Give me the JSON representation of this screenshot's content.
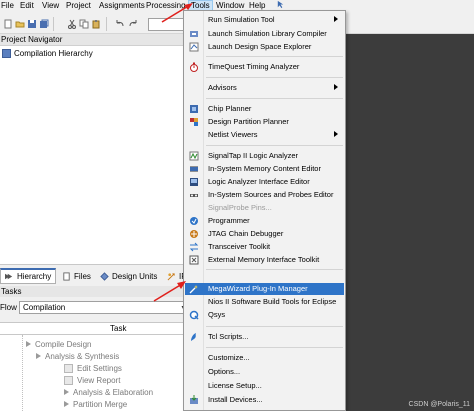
{
  "menubar": {
    "items": [
      "File",
      "Edit",
      "View",
      "Project",
      "Assignments",
      "Processing",
      "Tools",
      "Window",
      "Help"
    ]
  },
  "project_navigator": {
    "title": "Project Navigator",
    "root": "Compilation Hierarchy",
    "tabs": [
      "Hierarchy",
      "Files",
      "Design Units",
      "IP"
    ]
  },
  "tasks": {
    "title": "Tasks",
    "flow_label": "Flow:",
    "flow_value": "Compilation",
    "column_header": "Task",
    "rows": [
      "Compile Design",
      "Analysis & Synthesis",
      "Edit Settings",
      "View Report",
      "Analysis & Elaboration",
      "Partition Merge"
    ]
  },
  "tools_menu": {
    "items": [
      {
        "label": "Run Simulation Tool",
        "submenu": true,
        "icon": "simulation-icon"
      },
      {
        "label": "Launch Simulation Library Compiler",
        "icon": "library-compiler-icon"
      },
      {
        "label": "Launch Design Space Explorer",
        "icon": "design-space-explorer-icon"
      },
      {
        "label": "TimeQuest Timing Analyzer",
        "icon": "stopwatch-icon"
      },
      {
        "label": "Advisors",
        "submenu": true
      },
      {
        "label": "Chip Planner",
        "icon": "chip-planner-icon"
      },
      {
        "label": "Design Partition Planner",
        "icon": "partition-planner-icon"
      },
      {
        "label": "Netlist Viewers",
        "submenu": true
      },
      {
        "label": "SignalTap II Logic Analyzer",
        "icon": "signaltap-icon"
      },
      {
        "label": "In-System Memory Content Editor",
        "icon": "memory-editor-icon"
      },
      {
        "label": "Logic Analyzer Interface Editor",
        "icon": "logic-analyzer-icon"
      },
      {
        "label": "In-System Sources and Probes Editor",
        "icon": "sources-probes-icon"
      },
      {
        "label": "SignalProbe Pins...",
        "disabled": true
      },
      {
        "label": "Programmer",
        "icon": "programmer-icon"
      },
      {
        "label": "JTAG Chain Debugger",
        "icon": "jtag-icon"
      },
      {
        "label": "Transceiver Toolkit",
        "icon": "transceiver-icon"
      },
      {
        "label": "External Memory Interface Toolkit",
        "icon": "memory-toolkit-icon"
      },
      {
        "label": "MegaWizard Plug-In Manager",
        "icon": "megawizard-icon",
        "highlighted": true
      },
      {
        "label": "Nios II Software Build Tools for Eclipse"
      },
      {
        "label": "Qsys",
        "icon": "qsys-icon"
      },
      {
        "label": "Tcl Scripts...",
        "icon": "tcl-icon"
      },
      {
        "label": "Customize..."
      },
      {
        "label": "Options..."
      },
      {
        "label": "License Setup..."
      },
      {
        "label": "Install Devices...",
        "icon": "install-devices-icon"
      }
    ]
  },
  "watermark": "CSDN @Polaris_11",
  "colors": {
    "highlight": "#2e74c8",
    "annotation": "#e0201c",
    "workspace": "#3c3c3c"
  }
}
